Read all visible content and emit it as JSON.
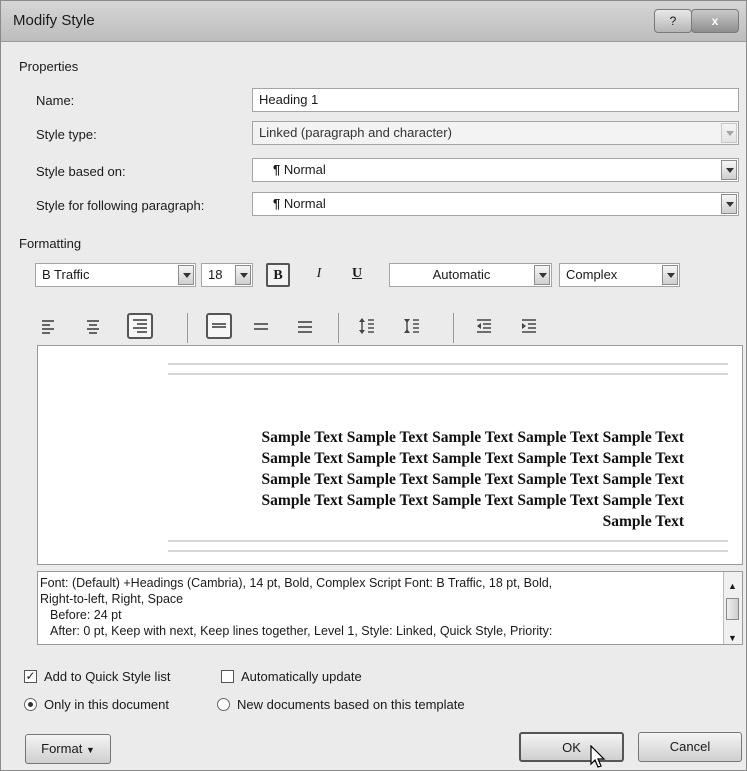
{
  "window": {
    "title": "Modify Style",
    "help_label": "?",
    "close_label": "x"
  },
  "properties": {
    "group_label": "Properties",
    "name_label": "Name:",
    "name_value": "Heading 1",
    "style_type_label": "Style type:",
    "style_type_value": "Linked (paragraph and character)",
    "based_on_label": "Style based on:",
    "based_on_value": "Normal",
    "following_label": "Style for following paragraph:",
    "following_value": "Normal",
    "paragraph_glyph": "¶"
  },
  "formatting": {
    "group_label": "Formatting",
    "font": "B Traffic",
    "size": "18",
    "bold_label": "B",
    "italic_label": "I",
    "underline_label": "U",
    "color": "Automatic",
    "script": "Complex",
    "icons": [
      "align-left-icon",
      "align-center-icon",
      "align-right-icon",
      "line-spacing-single-icon",
      "line-spacing-1-5-icon",
      "line-spacing-double-icon",
      "space-before-icon",
      "space-after-icon",
      "decrease-indent-icon",
      "increase-indent-icon"
    ]
  },
  "preview": {
    "lines": [
      "Sample Text Sample Text Sample Text Sample Text Sample Text",
      "Sample Text Sample Text Sample Text Sample Text Sample Text",
      "Sample Text Sample Text Sample Text Sample Text Sample Text",
      "Sample Text Sample Text Sample Text Sample Text Sample Text",
      "Sample Text"
    ]
  },
  "description": {
    "line1": "Font: (Default) +Headings (Cambria), 14 pt, Bold, Complex Script Font: B Traffic, 18 pt, Bold,",
    "line2": "Right-to-left, Right, Space",
    "line3": "Before:  24 pt",
    "line4": "After:  0 pt, Keep with next, Keep lines together, Level 1, Style: Linked, Quick Style, Priority:"
  },
  "options": {
    "quick_style": "Add to Quick Style list",
    "quick_style_checked": true,
    "auto_update": "Automatically update",
    "auto_update_checked": false,
    "only_doc": "Only in this document",
    "new_docs": "New documents based on this template"
  },
  "buttons": {
    "format": "Format",
    "ok": "OK",
    "cancel": "Cancel"
  }
}
